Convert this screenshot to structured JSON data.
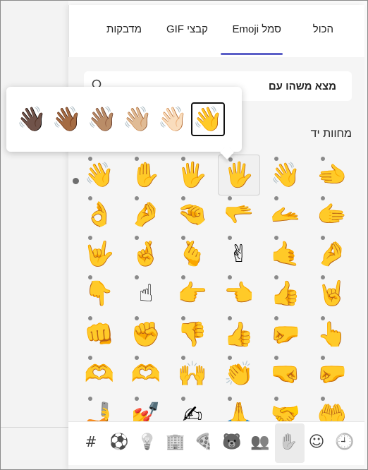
{
  "tabs": [
    {
      "id": "all",
      "label": "הכול"
    },
    {
      "id": "emoji",
      "label": "סמל Emoji"
    },
    {
      "id": "gif",
      "label": "קבצי GIF"
    },
    {
      "id": "stickers",
      "label": "מדבקות"
    }
  ],
  "active_tab": "emoji",
  "search": {
    "placeholder": "מצא משהו עם",
    "value": ""
  },
  "category": {
    "label": "מחוות יד"
  },
  "skin_tones": [
    "👋",
    "👋🏻",
    "👋🏼",
    "👋🏽",
    "👋🏾",
    "👋🏿"
  ],
  "grid": [
    [
      "👋",
      "✋",
      "🖐",
      "🖐",
      "👋",
      "🫲"
    ],
    [
      "👌",
      "🤌",
      "🤏",
      "🫳",
      "🫴",
      "🫱"
    ],
    [
      "🤟",
      "🤞",
      "🫰",
      "✌",
      "🤙",
      "🤌"
    ],
    [
      "👇",
      "☝",
      "👉",
      "👈",
      "👍",
      "🤘"
    ],
    [
      "👊",
      "✊",
      "👎",
      "👍",
      "🤛",
      "👆"
    ],
    [
      "🫶",
      "🫶",
      "🙌",
      "👏",
      "🤜",
      "🤛"
    ],
    [
      "🤳",
      "💅",
      "✍",
      "🙏",
      "🤝",
      "🤲"
    ]
  ],
  "bottom_bar": [
    {
      "name": "recent",
      "symbol": "🕘"
    },
    {
      "name": "smileys",
      "symbol": "☺"
    },
    {
      "name": "hand-gestures",
      "symbol": "✋"
    },
    {
      "name": "people",
      "symbol": "👥"
    },
    {
      "name": "animals",
      "symbol": "🐻"
    },
    {
      "name": "food",
      "symbol": "🍕"
    },
    {
      "name": "travel",
      "symbol": "🏢"
    },
    {
      "name": "objects",
      "symbol": "💡"
    },
    {
      "name": "activities",
      "symbol": "⚽"
    },
    {
      "name": "symbols",
      "symbol": "#"
    }
  ],
  "colors": {
    "accent": "#5b5fc7"
  }
}
